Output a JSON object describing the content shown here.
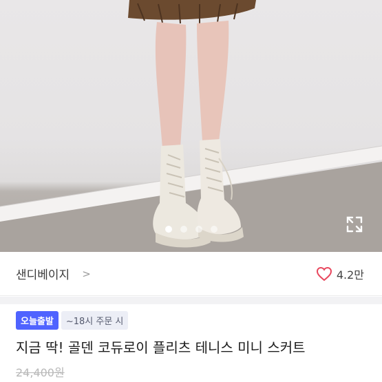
{
  "carousel": {
    "page_count": 4,
    "active_index": 0,
    "expand_icon": "expand-arrows-icon"
  },
  "shop": {
    "name": "샌디베이지",
    "chevron": ">",
    "like_icon": "heart-outline-icon",
    "like_count": "4.2만",
    "like_color": "#e8475d"
  },
  "badges": {
    "today": "오늘출발",
    "order": "~18시 주문 시",
    "accent": "#4f63ff"
  },
  "product": {
    "title": "지금 딱! 골덴 코듀로이 플리츠 테니스 미니 스커트",
    "original_price": "24,400원"
  }
}
